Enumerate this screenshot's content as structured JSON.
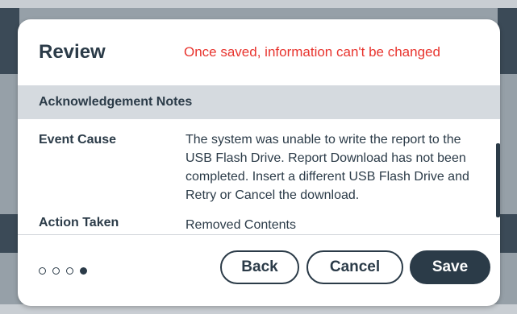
{
  "dialog": {
    "title": "Review",
    "warning": "Once saved, information can't be changed",
    "section_title": "Acknowledgement Notes",
    "fields": [
      {
        "label": "Event Cause",
        "value": "The system was unable to write the report to the USB Flash Drive. Report Download has not been completed. Insert a different USB Flash Drive and Retry or Cancel the download."
      },
      {
        "label": "Action Taken",
        "value": "Removed Contents"
      }
    ],
    "pagination": {
      "total": 4,
      "current": 4
    },
    "buttons": {
      "back": "Back",
      "cancel": "Cancel",
      "save": "Save"
    }
  },
  "colors": {
    "accent": "#2b3b48",
    "warning": "#e8342e",
    "section_bg": "#d5dadf"
  }
}
